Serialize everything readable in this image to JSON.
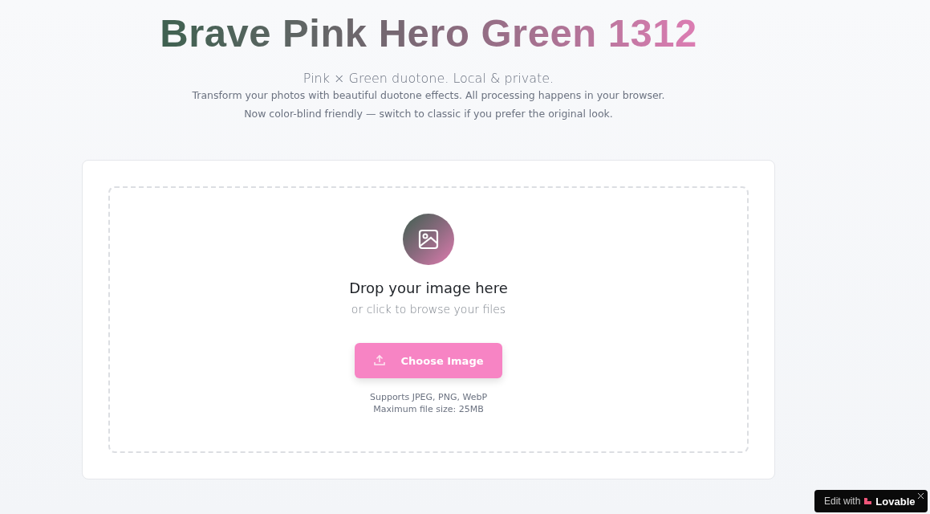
{
  "header": {
    "title": "Brave Pink Hero Green 1312",
    "tagline": "Pink × Green duotone. Local & private.",
    "description": [
      "Transform your photos with beautiful duotone effects. All processing happens in your browser.",
      "Now color-blind friendly — switch to classic if you prefer the original look."
    ]
  },
  "dropzone": {
    "heading": "Drop your image here",
    "subheading": "or click to browse your files",
    "button": "Choose Image",
    "notes": [
      "Supports JPEG, PNG, WebP",
      "Maximum file size: 25MB"
    ]
  },
  "badge": {
    "prefix": "Edit with",
    "brand": "Lovable"
  }
}
